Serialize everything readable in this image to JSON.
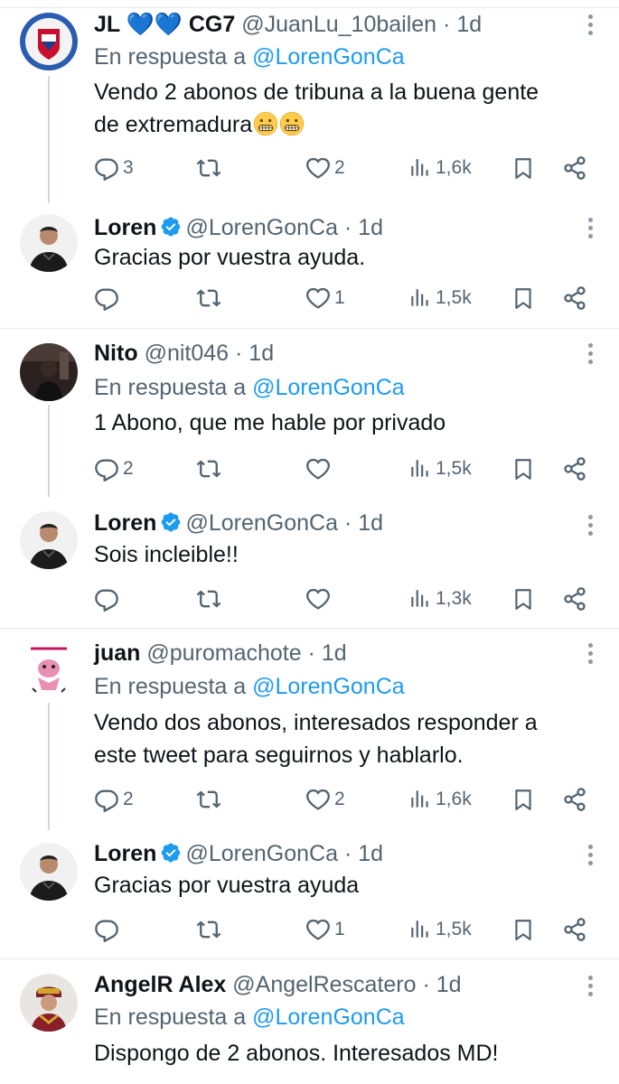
{
  "tweets": [
    {
      "name": "JL 💙💙 CG7",
      "handle": "@JuanLu_10bailen",
      "dot": "·",
      "time": "1d",
      "reply_prefix": "En respuesta a",
      "reply_to": "@LorenGonCa",
      "text_line1": "Vendo 2 abonos de tribuna a la buena gente",
      "text_line2": "de extremadura",
      "emoji": [
        "grimacing-face-emoji",
        "grimacing-face-emoji"
      ],
      "replies": "3",
      "retweets": "",
      "likes": "2",
      "views": "1,6k"
    },
    {
      "name": "Loren",
      "verified": true,
      "handle": "@LorenGonCa",
      "dot": "·",
      "time": "1d",
      "text": "Gracias por vuestra ayuda.",
      "replies": "",
      "retweets": "",
      "likes": "1",
      "views": "1,5k"
    },
    {
      "name": "Nito",
      "handle": "@nit046",
      "dot": "·",
      "time": "1d",
      "reply_prefix": "En respuesta a",
      "reply_to": "@LorenGonCa",
      "text": "1 Abono, que me hable por privado",
      "replies": "2",
      "retweets": "",
      "likes": "",
      "views": "1,5k"
    },
    {
      "name": "Loren",
      "verified": true,
      "handle": "@LorenGonCa",
      "dot": "·",
      "time": "1d",
      "text": "Sois incleible!!",
      "replies": "",
      "retweets": "",
      "likes": "",
      "views": "1,3k"
    },
    {
      "name": "juan",
      "handle": "@puromachote",
      "dot": "·",
      "time": "1d",
      "reply_prefix": "En respuesta a",
      "reply_to": "@LorenGonCa",
      "text_line1": "Vendo dos abonos, interesados responder a",
      "text_line2": "este tweet para seguirnos y hablarlo.",
      "replies": "2",
      "retweets": "",
      "likes": "2",
      "views": "1,6k"
    },
    {
      "name": "Loren",
      "verified": true,
      "handle": "@LorenGonCa",
      "dot": "·",
      "time": "1d",
      "text": "Gracias por vuestra ayuda",
      "replies": "",
      "retweets": "",
      "likes": "1",
      "views": "1,5k"
    },
    {
      "name": "AngelR Alex",
      "handle": "@AngelRescatero",
      "dot": "·",
      "time": "1d",
      "reply_prefix": "En respuesta a",
      "reply_to": "@LorenGonCa",
      "text": "Dispongo de 2 abonos. Interesados MD!"
    }
  ],
  "colors": {
    "text": "#0f1419",
    "muted": "#536471",
    "link": "#1d9bf0",
    "verified": "#1d9bf0",
    "divider": "#e7e9ea"
  },
  "icons": [
    "reply-icon",
    "retweet-icon",
    "like-icon",
    "views-icon",
    "bookmark-icon",
    "share-icon",
    "more-icon",
    "verified-badge-icon"
  ]
}
